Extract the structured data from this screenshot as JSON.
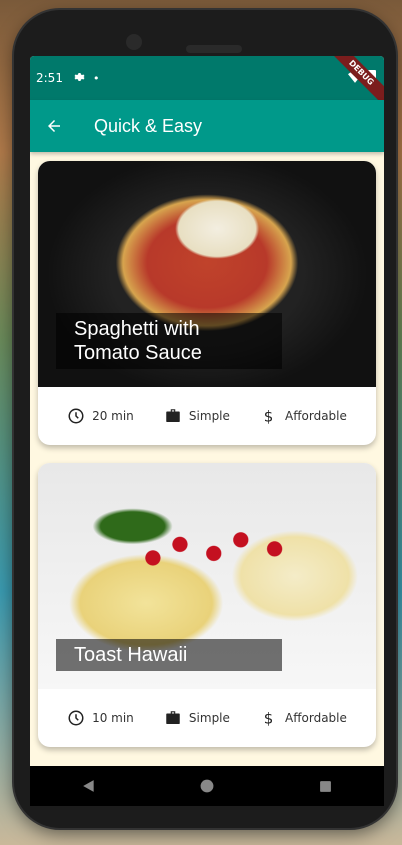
{
  "status_bar": {
    "time": "2:51",
    "dot": "•",
    "debug_label": "DEBUG"
  },
  "app_bar": {
    "title": "Quick & Easy",
    "back_icon": "arrow-left-icon"
  },
  "meals": [
    {
      "title": "Spaghetti with Tomato Sauce",
      "duration": "20 min",
      "complexity": "Simple",
      "affordability": "Affordable"
    },
    {
      "title": "Toast Hawaii",
      "duration": "10 min",
      "complexity": "Simple",
      "affordability": "Affordable"
    }
  ],
  "colors": {
    "status_bar": "#00796b",
    "app_bar": "#00998a",
    "background": "#fff8e1"
  }
}
